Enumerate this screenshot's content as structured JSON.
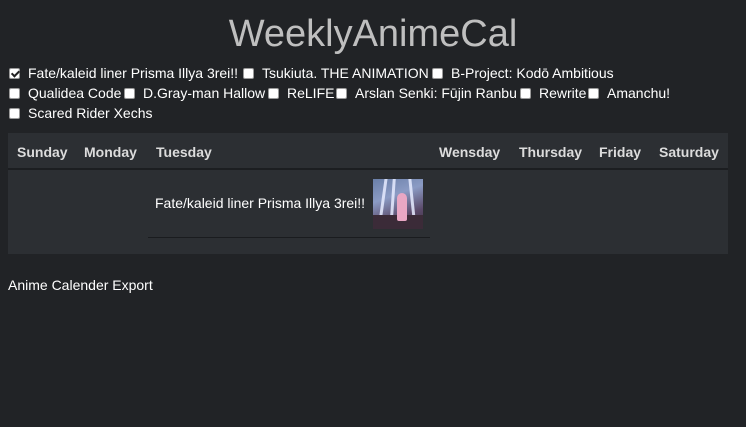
{
  "app": {
    "title": "WeeklyAnimeCal"
  },
  "shows": [
    {
      "label": "Fate/kaleid liner Prisma Illya 3rei!!",
      "checked": true
    },
    {
      "label": "Tsukiuta. THE ANIMATION",
      "checked": false
    },
    {
      "label": "B-Project: Kodō Ambitious",
      "checked": false
    },
    {
      "label": "Qualidea Code",
      "checked": false
    },
    {
      "label": "D.Gray-man Hallow",
      "checked": false
    },
    {
      "label": "ReLIFE",
      "checked": false
    },
    {
      "label": "Arslan Senki: Fūjin Ranbu",
      "checked": false
    },
    {
      "label": "Rewrite",
      "checked": false
    },
    {
      "label": "Amanchu!",
      "checked": false
    },
    {
      "label": "Scared Rider Xechs",
      "checked": false
    }
  ],
  "calendar": {
    "days": [
      "Sunday",
      "Monday",
      "Tuesday",
      "Wensday",
      "Thursday",
      "Friday",
      "Saturday"
    ],
    "entries": [
      {
        "day": "Tuesday",
        "title": "Fate/kaleid liner Prisma Illya 3rei!!",
        "thumbnail_icon": "anime-thumbnail"
      }
    ]
  },
  "footer": {
    "export_label": "Anime Calender Export"
  }
}
